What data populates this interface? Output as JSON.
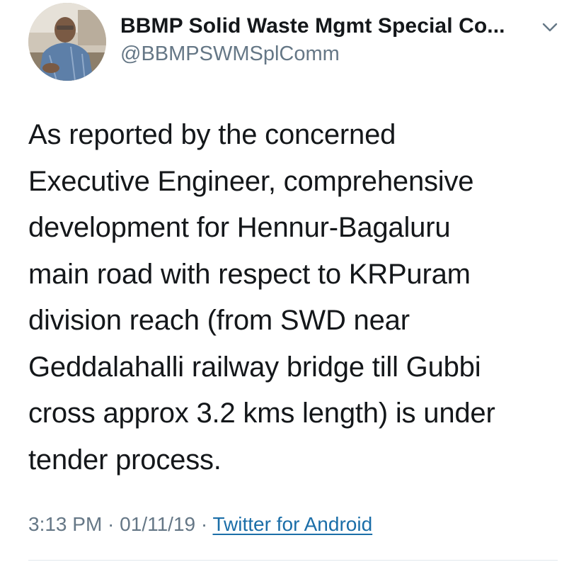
{
  "header": {
    "display_name": "BBMP Solid Waste Mgmt Special Co...",
    "handle": "@BBMPSWMSplComm"
  },
  "icons": {
    "avatar": "profile-photo",
    "menu": "chevron-down-icon"
  },
  "tweet": {
    "text": "As reported by the concerned\nExecutive Engineer, comprehensive\ndevelopment for Hennur-Bagaluru\nmain road with respect to KRPuram\ndivision reach (from SWD near\nGeddalahalli railway bridge till Gubbi\ncross approx 3.2 kms length) is under\ntender process."
  },
  "meta": {
    "time": "3:13 PM",
    "separator_1": " · ",
    "date": "01/11/19",
    "separator_2": " · ",
    "source": "Twitter for Android"
  },
  "colors": {
    "text_primary": "#14171a",
    "text_secondary": "#657786",
    "link": "#1b6ea8",
    "divider": "#e1e8ed"
  }
}
